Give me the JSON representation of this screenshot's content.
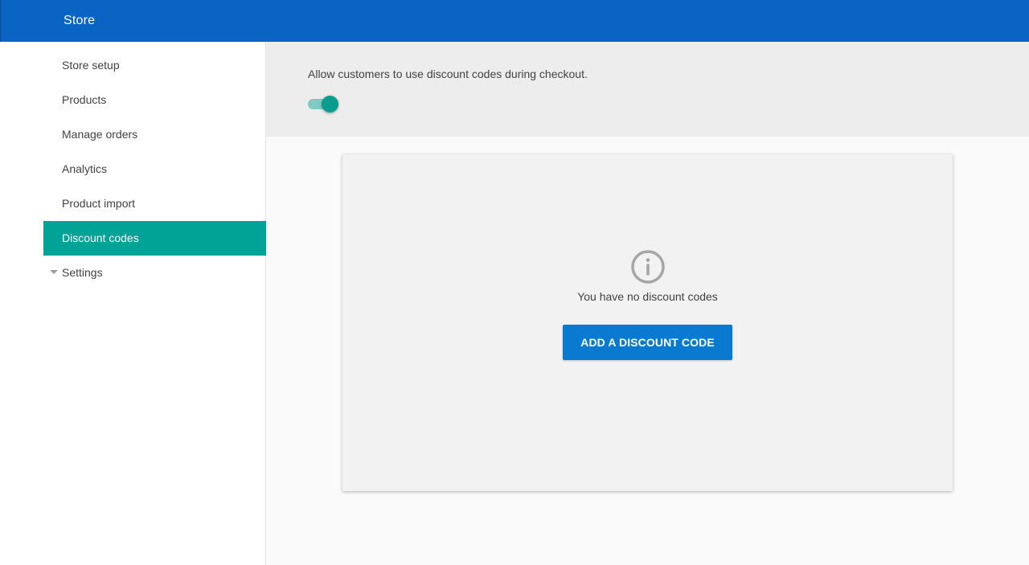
{
  "header": {
    "title": "Store"
  },
  "sidebar": {
    "items": [
      {
        "label": "Store setup"
      },
      {
        "label": "Products"
      },
      {
        "label": "Manage orders"
      },
      {
        "label": "Analytics"
      },
      {
        "label": "Product import"
      },
      {
        "label": "Discount codes",
        "active": true
      },
      {
        "label": "Settings",
        "icon": "caret-down-icon",
        "expandable": true
      }
    ]
  },
  "banner": {
    "description": "Allow customers to use discount codes during checkout.",
    "toggle_on": true
  },
  "empty_state": {
    "icon": "info-icon",
    "message": "You have no discount codes",
    "button_label": "ADD A DISCOUNT CODE"
  },
  "colors": {
    "header": "#0a64c4",
    "active_nav": "#00a396",
    "toggle_thumb": "#0a9d8e",
    "button": "#0a7ad1"
  }
}
